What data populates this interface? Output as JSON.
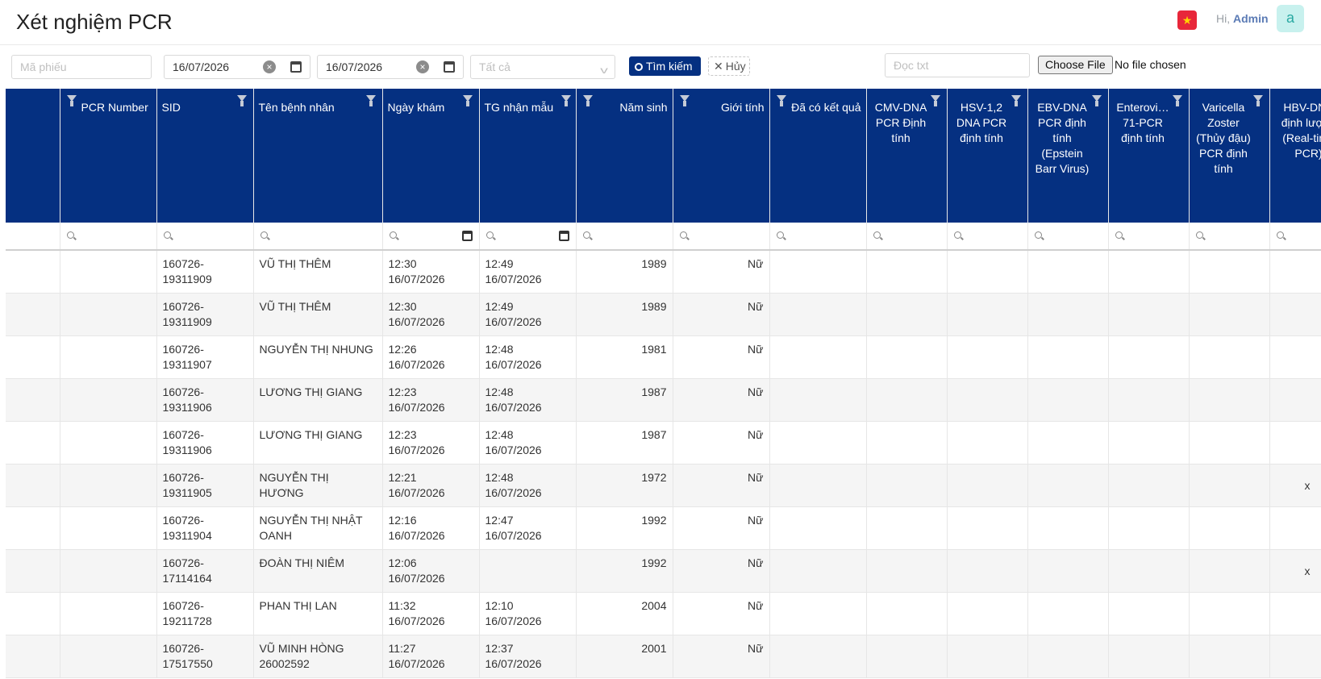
{
  "header": {
    "title": "Xét nghiệm PCR",
    "greeting_prefix": "Hi,",
    "user": "Admin",
    "avatar_letter": "a",
    "flag_star": "★"
  },
  "toolbar": {
    "ma_phieu_placeholder": "Mã phiếu",
    "date_from": "16/07/2026",
    "date_to": "16/07/2026",
    "status_select": "Tất cả",
    "search_label": "Tìm kiếm",
    "cancel_label": "Hủy",
    "doc_txt_placeholder": "Đọc txt",
    "file_button": "Choose File",
    "file_status": "No file chosen"
  },
  "columns": [
    {
      "label": ""
    },
    {
      "label": "PCR Number"
    },
    {
      "label": "SID"
    },
    {
      "label": "Tên bệnh nhân"
    },
    {
      "label": "Ngày khám"
    },
    {
      "label": "TG nhận mẫu"
    },
    {
      "label": "Năm sinh"
    },
    {
      "label": "Giới tính"
    },
    {
      "label": "Đã có kết quả"
    },
    {
      "label": "CMV-DNA PCR Định tính"
    },
    {
      "label": "HSV-1,2 DNA PCR định tính"
    },
    {
      "label": "EBV-DNA PCR định tính (Epstein Barr Virus)"
    },
    {
      "label": "Enterovi… 71-PCR định tính"
    },
    {
      "label": "Varicella Zoster (Thủy đậu) PCR định tính"
    },
    {
      "label": "HBV-DNA định lượng (Real-time PCR)"
    }
  ],
  "rows": [
    {
      "sid1": "160726-",
      "sid2": "19311909",
      "name1": "VŨ THỊ THÊM",
      "name2": "",
      "kham1": "12:30",
      "kham2": "16/07/2026",
      "nhan1": "12:49",
      "nhan2": "16/07/2026",
      "nam": "1989",
      "gt": "Nữ",
      "hbv": ""
    },
    {
      "sid1": "160726-",
      "sid2": "19311909",
      "name1": "VŨ THỊ THÊM",
      "name2": "",
      "kham1": "12:30",
      "kham2": "16/07/2026",
      "nhan1": "12:49",
      "nhan2": "16/07/2026",
      "nam": "1989",
      "gt": "Nữ",
      "hbv": ""
    },
    {
      "sid1": "160726-",
      "sid2": "19311907",
      "name1": "NGUYỄN THỊ NHUNG",
      "name2": "",
      "kham1": "12:26",
      "kham2": "16/07/2026",
      "nhan1": "12:48",
      "nhan2": "16/07/2026",
      "nam": "1981",
      "gt": "Nữ",
      "hbv": ""
    },
    {
      "sid1": "160726-",
      "sid2": "19311906",
      "name1": "LƯƠNG THỊ GIANG",
      "name2": "",
      "kham1": "12:23",
      "kham2": "16/07/2026",
      "nhan1": "12:48",
      "nhan2": "16/07/2026",
      "nam": "1987",
      "gt": "Nữ",
      "hbv": ""
    },
    {
      "sid1": "160726-",
      "sid2": "19311906",
      "name1": "LƯƠNG THỊ GIANG",
      "name2": "",
      "kham1": "12:23",
      "kham2": "16/07/2026",
      "nhan1": "12:48",
      "nhan2": "16/07/2026",
      "nam": "1987",
      "gt": "Nữ",
      "hbv": ""
    },
    {
      "sid1": "160726-",
      "sid2": "19311905",
      "name1": "NGUYỄN THỊ",
      "name2": "HƯƠNG",
      "kham1": "12:21",
      "kham2": "16/07/2026",
      "nhan1": "12:48",
      "nhan2": "16/07/2026",
      "nam": "1972",
      "gt": "Nữ",
      "hbv": "x"
    },
    {
      "sid1": "160726-",
      "sid2": "19311904",
      "name1": "NGUYỄN THỊ NHẬT",
      "name2": "OANH",
      "kham1": "12:16",
      "kham2": "16/07/2026",
      "nhan1": "12:47",
      "nhan2": "16/07/2026",
      "nam": "1992",
      "gt": "Nữ",
      "hbv": ""
    },
    {
      "sid1": "160726-",
      "sid2": "17114164",
      "name1": "ĐOÀN THỊ NIÊM",
      "name2": "",
      "kham1": "12:06",
      "kham2": "16/07/2026",
      "nhan1": "",
      "nhan2": "",
      "nam": "1992",
      "gt": "Nữ",
      "hbv": "x"
    },
    {
      "sid1": "160726-",
      "sid2": "19211728",
      "name1": "PHAN THỊ LAN",
      "name2": "",
      "kham1": "11:32",
      "kham2": "16/07/2026",
      "nhan1": "12:10",
      "nhan2": "16/07/2026",
      "nam": "2004",
      "gt": "Nữ",
      "hbv": ""
    },
    {
      "sid1": "160726-",
      "sid2": "17517550",
      "name1": "VŨ MINH HÒNG",
      "name2": "26002592",
      "kham1": "11:27",
      "kham2": "16/07/2026",
      "nhan1": "12:37",
      "nhan2": "16/07/2026",
      "nam": "2001",
      "gt": "Nữ",
      "hbv": ""
    }
  ]
}
